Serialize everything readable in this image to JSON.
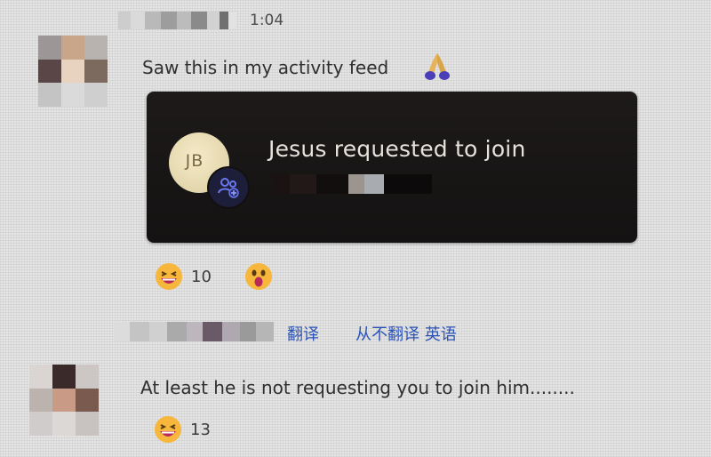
{
  "messages": [
    {
      "time": "1:04",
      "text": "Saw this in my activity feed",
      "card": {
        "avatar_initials": "JB",
        "title": "Jesus requested to join"
      },
      "reactions": [
        {
          "icon": "laughing-emoji-icon",
          "count": "10"
        },
        {
          "icon": "surprised-emoji-icon",
          "count": ""
        }
      ]
    },
    {
      "translate_label": "翻译",
      "no_translate_label": "从不翻译 英语",
      "text": "At least he is not requesting you to join him........",
      "reactions": [
        {
          "icon": "laughing-emoji-icon",
          "count": "13"
        }
      ]
    }
  ],
  "colors": {
    "card_background": "#1a1716",
    "link": "#2b53b8",
    "badge_accent": "#5865d8",
    "page_background": "#e4e4e4"
  }
}
